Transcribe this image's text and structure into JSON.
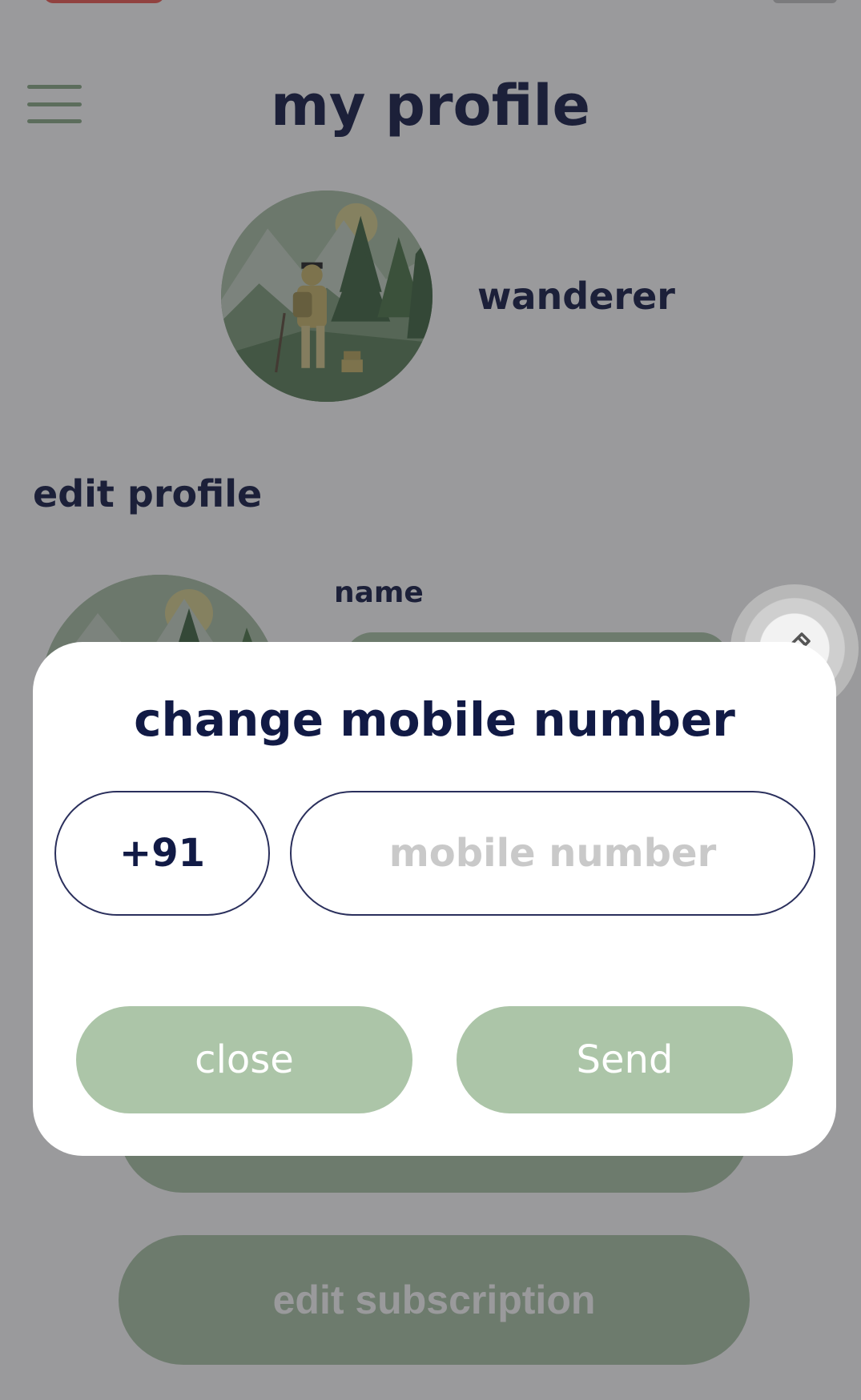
{
  "header": {
    "title": "my profile"
  },
  "profile": {
    "username": "wanderer"
  },
  "edit_profile": {
    "section_title": "edit profile",
    "name_label": "name",
    "subscription_button": "edit subscription"
  },
  "modal": {
    "title": "change mobile number",
    "country_code": "+91",
    "phone_placeholder": "mobile number",
    "close_label": "close",
    "send_label": "Send"
  },
  "colors": {
    "navy_text": "#111a45",
    "sage_green": "#acc5a8",
    "scrim": "rgba(40,40,44,0.47)",
    "status_red": "#ef5a52"
  },
  "icons": {
    "menu": "hamburger-menu-icon",
    "edit": "pencil-icon"
  }
}
